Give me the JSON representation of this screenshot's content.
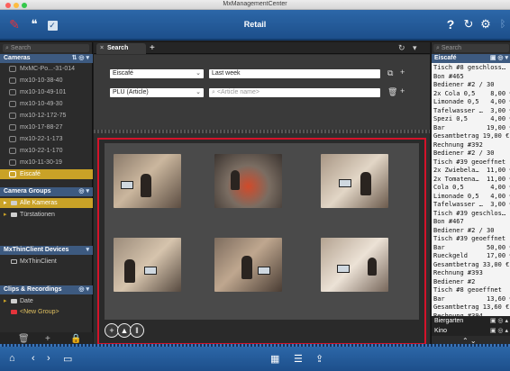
{
  "window": {
    "title": "MxManagementCenter"
  },
  "toolbar": {
    "app_title": "Retail",
    "help_icon": "?",
    "refresh_icon": "↻",
    "settings_icon": "⚙",
    "bluetooth_icon": "ᛒ"
  },
  "left": {
    "search_placeholder": "Search",
    "cameras_header": "Cameras",
    "cameras": [
      "MxMC-Po...-31-014",
      "mx10-10-38-40",
      "mx10-10-49-101",
      "mx10-10-49-30",
      "mx10-12-172-75",
      "mx10-17-88-27",
      "mx10-22-1-173",
      "mx10-22-1-170",
      "mx10-11-30-19",
      "Eiscafé"
    ],
    "groups_header": "Camera Groups",
    "groups": [
      "Alle Kameras",
      "Türstationen"
    ],
    "devices_header": "MxThinClient Devices",
    "devices": [
      "MxThinClient"
    ],
    "clips_header": "Clips & Recordings",
    "clips": [
      "Date",
      "<New Group>"
    ]
  },
  "center": {
    "tab_label": "Search",
    "filter": {
      "source": "Eiscafé",
      "period": "Last week",
      "type": "PLU (Article)",
      "article_placeholder": "<Article name>"
    }
  },
  "right": {
    "search_placeholder": "Search",
    "header": "Eiscafé",
    "receipt": [
      "Tisch #8 geschloss…",
      "Bon #465",
      "Bediener #2 / 30",
      "2x Cola 0,5    8,00 €",
      "Limonade 0,5   4,00 €",
      "Tafelwasser …  3,00 €",
      "Spezi 0,5      4,00 €",
      "Bar           19,00 €",
      "Gesamtbetrag 19,00 €",
      "Rechnung #392",
      "Bediener #2 / 30",
      "Tisch #39 geoeffnet",
      "2x Zwiebela…  11,00 €",
      "2x Tomatena…  11,00 €",
      "Cola 0,5       4,00 €",
      "Limonade 0,5   4,00 €",
      "Tafelwasser …  3,00 €",
      "Tisch #39 geschlos…",
      "Bon #467",
      "Bediener #2 / 30",
      "Tisch #39 geoeffnet",
      "Bar           50,00 €",
      "Rueckgeld     17,00 €",
      "Gesamtbetrag 33,00 €",
      "Rechnung #393",
      "Bediener #2",
      "Tisch #8 geoeffnet",
      "Bar           13,60 €",
      "Gesamtbetrag 13,60 €",
      "Rechnung #394",
      "Bediener #2"
    ],
    "footer_1": "Biergarten",
    "footer_2": "Kino"
  },
  "colors": {
    "accent_blue": "#2c67a8",
    "selection_gold": "#c9a227",
    "highlight_red": "#d3132a"
  }
}
